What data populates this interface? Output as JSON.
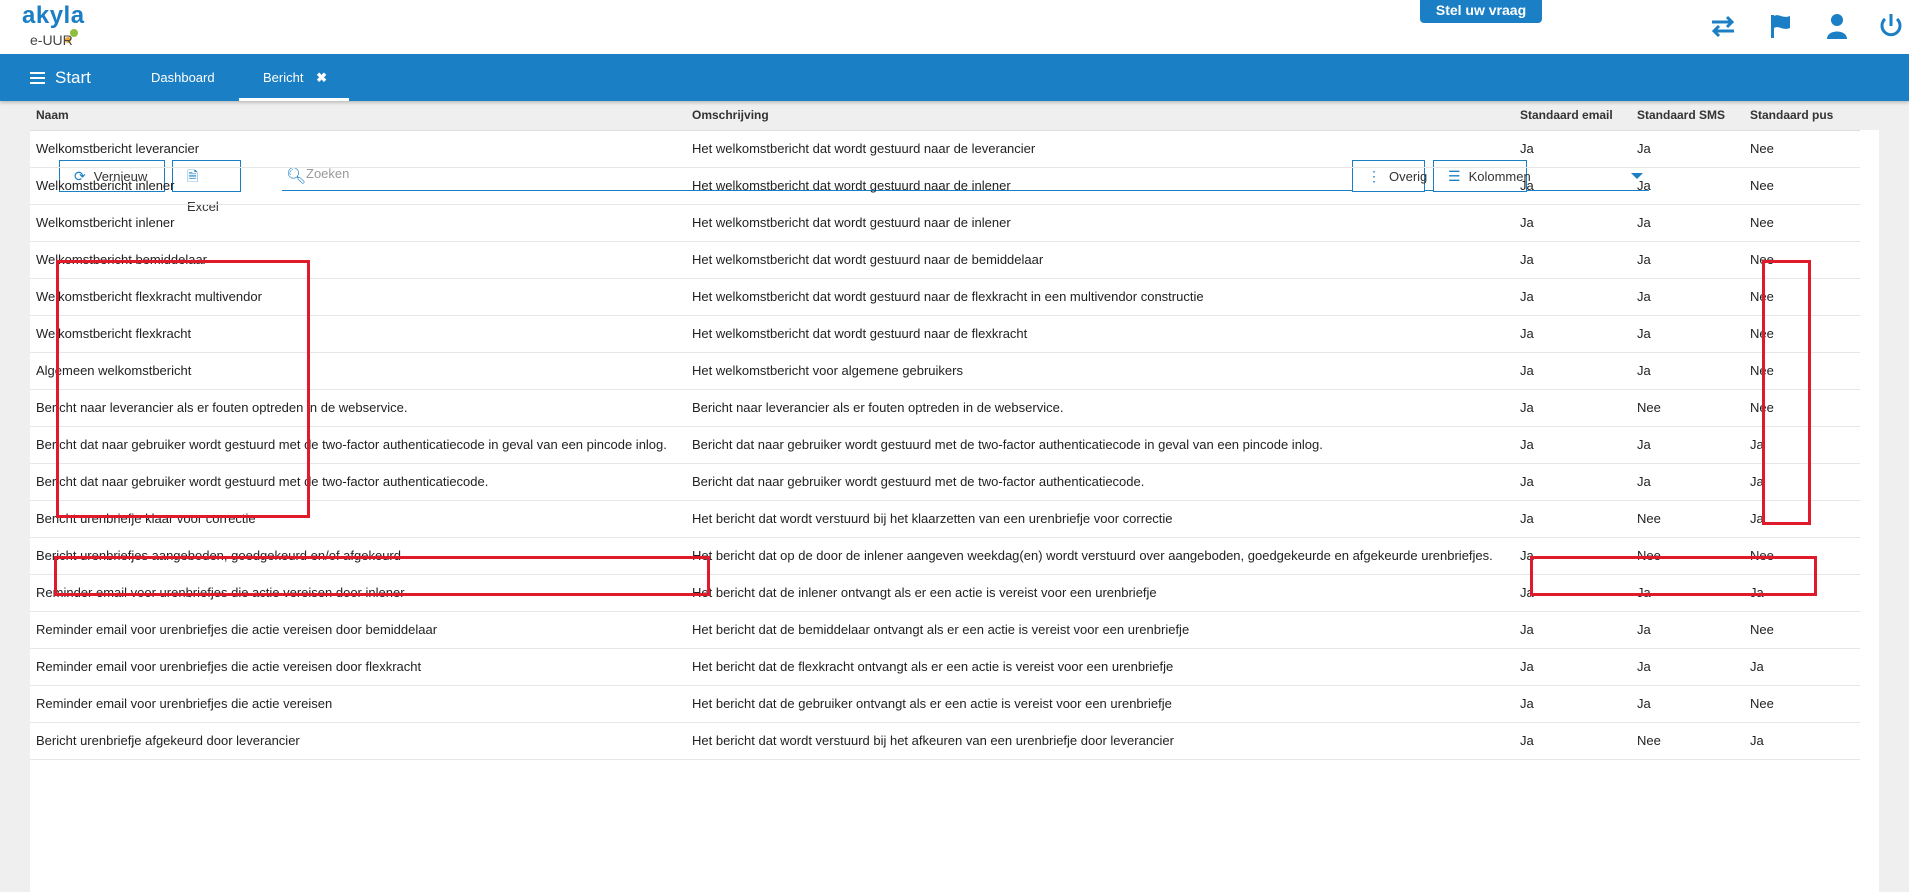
{
  "header": {
    "logo_text": "akyla",
    "logo_sub": "e-UUR",
    "ask_button": "Stel uw vraag",
    "icons": [
      "swap-icon",
      "flag-icon",
      "user-icon",
      "power-icon"
    ]
  },
  "nav": {
    "start_label": "Start",
    "tabs": [
      {
        "label": "Dashboard"
      },
      {
        "label": "Bericht"
      }
    ]
  },
  "toolbar": {
    "refresh_label": "Vernieuw",
    "excel_label": "Excel",
    "search_placeholder": "Zoeken",
    "more_label": "Overig",
    "columns_label": "Kolommen"
  },
  "table": {
    "headers": [
      "Naam",
      "Omschrijving",
      "Standaard email",
      "Standaard SMS",
      "Standaard pus"
    ],
    "rows": [
      [
        "Welkomstbericht leverancier",
        "Het welkomstbericht dat wordt gestuurd naar de leverancier",
        "Ja",
        "Ja",
        "Nee"
      ],
      [
        "Welkomstbericht inlener",
        "Het welkomstbericht dat wordt gestuurd naar de inlener",
        "Ja",
        "Ja",
        "Nee"
      ],
      [
        "Welkomstbericht inlener",
        "Het welkomstbericht dat wordt gestuurd naar de inlener",
        "Ja",
        "Ja",
        "Nee"
      ],
      [
        "Welkomstbericht bemiddelaar",
        "Het welkomstbericht dat wordt gestuurd naar de bemiddelaar",
        "Ja",
        "Ja",
        "Nee"
      ],
      [
        "Welkomstbericht flexkracht multivendor",
        "Het welkomstbericht dat wordt gestuurd naar de flexkracht in een multivendor constructie",
        "Ja",
        "Ja",
        "Nee"
      ],
      [
        "Welkomstbericht flexkracht",
        "Het welkomstbericht dat wordt gestuurd naar de flexkracht",
        "Ja",
        "Ja",
        "Nee"
      ],
      [
        "Algemeen welkomstbericht",
        "Het welkomstbericht voor algemene gebruikers",
        "Ja",
        "Ja",
        "Nee"
      ],
      [
        "Bericht naar leverancier als er fouten optreden in de webservice.",
        "Bericht naar leverancier als er fouten optreden in de webservice.",
        "Ja",
        "Nee",
        "Nee"
      ],
      [
        "Bericht dat naar gebruiker wordt gestuurd met de two-factor authenticatiecode in geval van een pincode inlog.",
        "Bericht dat naar gebruiker wordt gestuurd met de two-factor authenticatiecode in geval van een pincode inlog.",
        "Ja",
        "Ja",
        "Ja"
      ],
      [
        "Bericht dat naar gebruiker wordt gestuurd met de two-factor authenticatiecode.",
        "Bericht dat naar gebruiker wordt gestuurd met de two-factor authenticatiecode.",
        "Ja",
        "Ja",
        "Ja"
      ],
      [
        "Bericht urenbriefje klaar voor correctie",
        "Het bericht dat wordt verstuurd bij het klaarzetten van een urenbriefje voor correctie",
        "Ja",
        "Nee",
        "Ja"
      ],
      [
        "Bericht urenbriefjes aangeboden, goedgekeurd en/of afgekeurd",
        "Het bericht dat op de door de inlener aangeven weekdag(en) wordt verstuurd over aangeboden, goedgekeurde en afgekeurde urenbriefjes.",
        "Ja",
        "Nee",
        "Nee"
      ],
      [
        "Reminder email voor urenbriefjes die actie vereisen door inlener",
        "Het bericht dat de inlener ontvangt als er een actie is vereist voor een urenbriefje",
        "Ja",
        "Ja",
        "Ja"
      ],
      [
        "Reminder email voor urenbriefjes die actie vereisen door bemiddelaar",
        "Het bericht dat de bemiddelaar ontvangt als er een actie is vereist voor een urenbriefje",
        "Ja",
        "Ja",
        "Nee"
      ],
      [
        "Reminder email voor urenbriefjes die actie vereisen door flexkracht",
        "Het bericht dat de flexkracht ontvangt als er een actie is vereist voor een urenbriefje",
        "Ja",
        "Ja",
        "Ja"
      ],
      [
        "Reminder email voor urenbriefjes die actie vereisen",
        "Het bericht dat de gebruiker ontvangt als er een actie is vereist voor een urenbriefje",
        "Ja",
        "Ja",
        "Nee"
      ],
      [
        "Bericht urenbriefje afgekeurd door leverancier",
        "Het bericht dat wordt verstuurd bij het afkeuren van een urenbriefje door leverancier",
        "Ja",
        "Nee",
        "Ja"
      ]
    ]
  },
  "colors": {
    "brand": "#1a7fc4",
    "highlight": "#e0192b"
  }
}
